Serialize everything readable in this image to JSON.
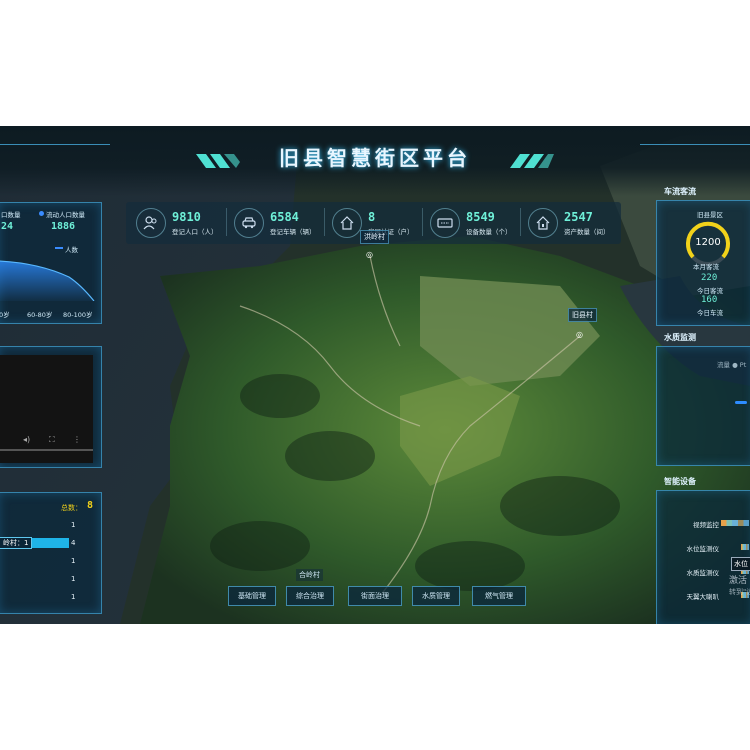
{
  "header": {
    "title": "旧县智慧街区平台"
  },
  "stats": [
    {
      "icon": "person-icon",
      "value": "9810",
      "label": "登记人口（人）"
    },
    {
      "icon": "car-icon",
      "value": "6584",
      "label": "登记车辆（辆）"
    },
    {
      "icon": "house-icon",
      "value": "8",
      "label": "房屋认证（户）"
    },
    {
      "icon": "device-icon",
      "value": "8549",
      "label": "设备数量（个）"
    },
    {
      "icon": "asset-icon",
      "value": "2547",
      "label": "资产数量（间）"
    }
  ],
  "left_population": {
    "legend1": "口数量",
    "legend2": "流动人口数量",
    "value1": "24",
    "value2": "1886",
    "series_label": "人数",
    "ticks": [
      "0岁",
      "60-80岁",
      "80-100岁"
    ]
  },
  "left_video": {
    "controls": [
      "volume-icon",
      "fullscreen-icon",
      "more-icon"
    ]
  },
  "left_list": {
    "total_label": "总数：",
    "total_value": "8",
    "highlight": "岭村：1",
    "rows": [
      "1",
      "4",
      "1",
      "1",
      "1"
    ]
  },
  "right_traffic": {
    "title": "车流客流",
    "place": "旧县景区",
    "gauge_value": "1200",
    "gauge_label": "本月客流",
    "today_passenger_value": "220",
    "today_passenger_label": "今日客流",
    "today_vehicle_value": "160",
    "today_vehicle_label": "今日车流"
  },
  "right_water": {
    "title": "水质监测",
    "legend": "流量 ● Pt"
  },
  "right_devices": {
    "title": "智能设备",
    "items": [
      "视频监控",
      "水位监测仪",
      "水质监测仪",
      "天翼大喇叭"
    ],
    "popup": "水位",
    "activation_line1": "激活 W",
    "activation_line2": "转到\"设"
  },
  "map_labels": {
    "top": "洪岭村",
    "village": "旧县村",
    "bottom": "合岭村"
  },
  "bottom_nav": [
    "基础管理",
    "综合治理",
    "街面治理",
    "水质管理",
    "燃气管理"
  ],
  "colors": {
    "accent": "#39c7ff",
    "value": "#6ff0d8",
    "gauge": "#f2d21a"
  }
}
